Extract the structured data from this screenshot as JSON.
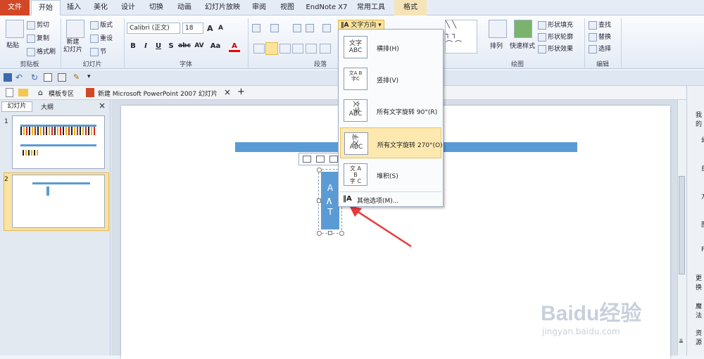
{
  "tabs": {
    "file": "文件",
    "home": "开始",
    "insert": "插入",
    "beautify": "美化",
    "design": "设计",
    "transitions": "切换",
    "animations": "动画",
    "slideshow": "幻灯片放映",
    "review": "审阅",
    "view": "视图",
    "endnote": "EndNote X7",
    "tools": "常用工具",
    "format": "格式"
  },
  "ribbon": {
    "clipboard": {
      "paste": "粘贴",
      "cut": "剪切",
      "copy": "复制",
      "format_painter": "格式刷",
      "label": "剪贴板"
    },
    "slides": {
      "new_slide": "新建\n幻灯片",
      "layout": "版式",
      "reset": "重设",
      "section": "节",
      "label": "幻灯片"
    },
    "font": {
      "name": "Calibri (正文)",
      "size": "18",
      "label": "字体",
      "bold": "B",
      "italic": "I",
      "underline": "U",
      "strike": "S",
      "abc": "abc",
      "spacing": "AV",
      "case": "Aa",
      "color": "A",
      "grow": "A",
      "shrink": "A"
    },
    "paragraph": {
      "label": "段落",
      "text_direction": "文字方向"
    },
    "drawing": {
      "arrange": "排列",
      "quick_styles": "快速样式",
      "shape_fill": "形状填充",
      "shape_outline": "形状轮廓",
      "shape_effects": "形状效果",
      "label": "绘图"
    },
    "editing": {
      "find": "查找",
      "replace": "替换",
      "select": "选择",
      "label": "编辑"
    }
  },
  "doc_tabs": {
    "template": "模板专区",
    "document": "新建 Microsoft PowerPoint 2007 幻灯片"
  },
  "left_panel": {
    "tab_slides": "幻灯片",
    "tab_outline": "大纲",
    "slide1_number": "1",
    "slide2_number": "2"
  },
  "shape_text": {
    "top": "A",
    "bottom": "T"
  },
  "text_direction_menu": {
    "items": [
      {
        "label": "横排(H)",
        "icon_text": "文字\nABC"
      },
      {
        "label": "竖排(V)",
        "icon_text": "文字\nABC"
      },
      {
        "label": "所有文字旋转 90°(R)",
        "icon_text": "文字\nABC"
      },
      {
        "label": "所有文字旋转 270°(O)",
        "icon_text": "文字\nABC"
      },
      {
        "label": "堆积(S)",
        "icon_text": "文字\nABC"
      }
    ],
    "more": "其他选项(M)...",
    "selected_index": 3
  },
  "right_panel": {
    "l1": "我的",
    "l2": "幻",
    "l3": "自",
    "l4": "方",
    "l5": "图",
    "l6": "P",
    "l7": "更换",
    "l8": "魔法",
    "l9": "资源"
  },
  "watermark": {
    "brand": "Baidu经验",
    "url": "jingyan.baidu.com"
  },
  "colors": {
    "accent": "#5b9bd5",
    "file_tab": "#d24726",
    "arrow": "#e8393a"
  }
}
